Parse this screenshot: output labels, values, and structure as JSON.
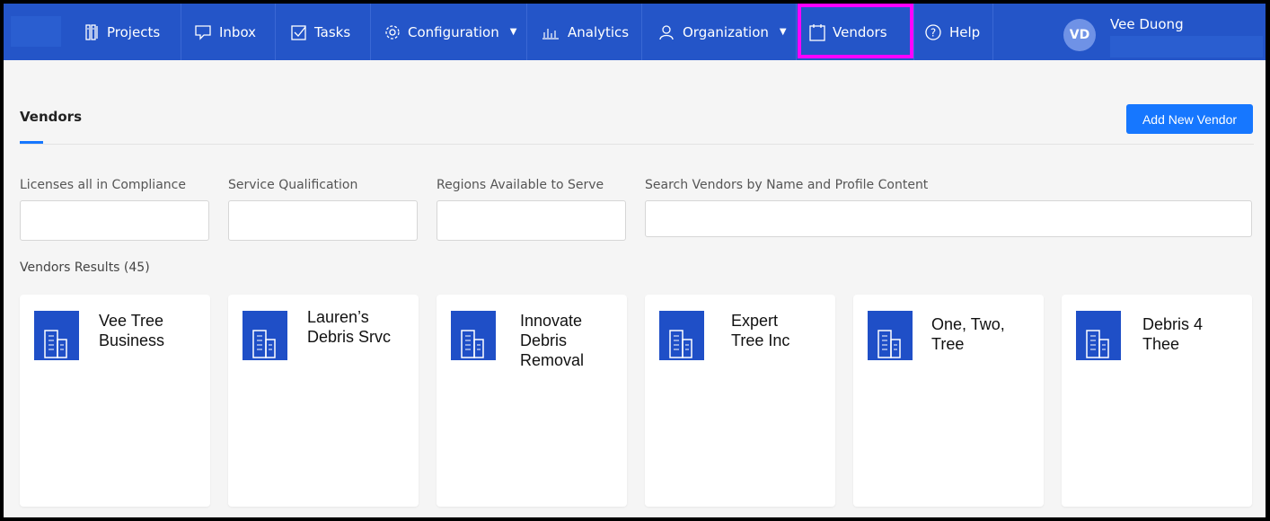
{
  "nav": {
    "items": [
      {
        "label": "Projects",
        "icon": "projects-icon"
      },
      {
        "label": "Inbox",
        "icon": "inbox-icon"
      },
      {
        "label": "Tasks",
        "icon": "tasks-icon"
      },
      {
        "label": "Configuration",
        "icon": "gear-icon",
        "dropdown": true
      },
      {
        "label": "Analytics",
        "icon": "analytics-icon"
      },
      {
        "label": "Organization",
        "icon": "people-icon",
        "dropdown": true
      },
      {
        "label": "Vendors",
        "icon": "clipboard-icon",
        "active": true
      },
      {
        "label": "Help",
        "icon": "help-icon"
      }
    ],
    "user": {
      "initials": "VD",
      "name": "Vee Duong"
    }
  },
  "page": {
    "title": "Vendors",
    "add_button": "Add New Vendor"
  },
  "filters": [
    {
      "label": "Licenses all in Compliance",
      "value": ""
    },
    {
      "label": "Service Qualification",
      "value": ""
    },
    {
      "label": "Regions Available to Serve",
      "value": ""
    },
    {
      "label": "Search Vendors by Name and Profile Content",
      "value": ""
    }
  ],
  "results": {
    "label": "Vendors Results (45)",
    "vendors": [
      {
        "name": "Vee Tree Business"
      },
      {
        "name": "Lauren’s Debris Srvc"
      },
      {
        "name": "Innovate Debris Removal"
      },
      {
        "name": "Expert Tree Inc"
      },
      {
        "name": "One, Two, Tree"
      },
      {
        "name": "Debris 4 Thee"
      }
    ]
  },
  "colors": {
    "nav_bg": "#2455c8",
    "accent": "#1677ff",
    "highlight": "#ff00ff"
  }
}
